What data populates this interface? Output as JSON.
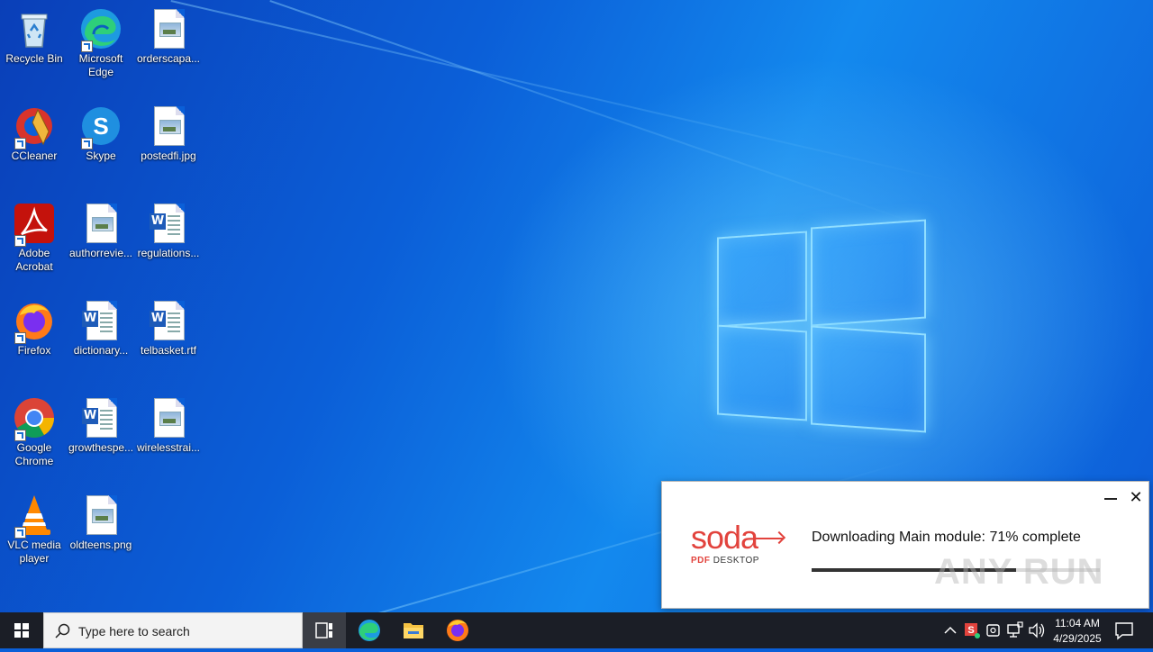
{
  "desktop_icons": [
    {
      "label": "Recycle Bin",
      "icon": "recycle-bin-icon"
    },
    {
      "label": "Microsoft Edge",
      "icon": "edge-icon"
    },
    {
      "label": "orderscapa...",
      "icon": "image-file-icon"
    },
    {
      "label": "CCleaner",
      "icon": "ccleaner-icon"
    },
    {
      "label": "Skype",
      "icon": "skype-icon"
    },
    {
      "label": "postedfi.jpg",
      "icon": "image-file-icon"
    },
    {
      "label": "Adobe Acrobat",
      "icon": "acrobat-icon"
    },
    {
      "label": "authorrevie...",
      "icon": "image-file-icon"
    },
    {
      "label": "regulations...",
      "icon": "word-doc-icon"
    },
    {
      "label": "Firefox",
      "icon": "firefox-icon"
    },
    {
      "label": "dictionary...",
      "icon": "word-doc-icon"
    },
    {
      "label": "telbasket.rtf",
      "icon": "word-doc-icon"
    },
    {
      "label": "Google Chrome",
      "icon": "chrome-icon"
    },
    {
      "label": "growthespe...",
      "icon": "word-doc-icon"
    },
    {
      "label": "wirelesstrai...",
      "icon": "image-file-icon"
    },
    {
      "label": "VLC media player",
      "icon": "vlc-icon"
    },
    {
      "label": "oldteens.png",
      "icon": "image-file-icon"
    }
  ],
  "popup": {
    "brand_word": "soda",
    "brand_sub_bold": "PDF",
    "brand_sub": " DESKTOP",
    "status": "Downloading Main module: 71% complete",
    "progress": 0.71,
    "watermark": "ANY RUN"
  },
  "taskbar": {
    "search_placeholder": "Type here to search",
    "time": "11:04 AM",
    "date": "4/29/2025"
  },
  "colors": {
    "accent_red": "#e2433d",
    "taskbar": "#1b1e26",
    "desktop_blue": "#0b5fd8"
  }
}
